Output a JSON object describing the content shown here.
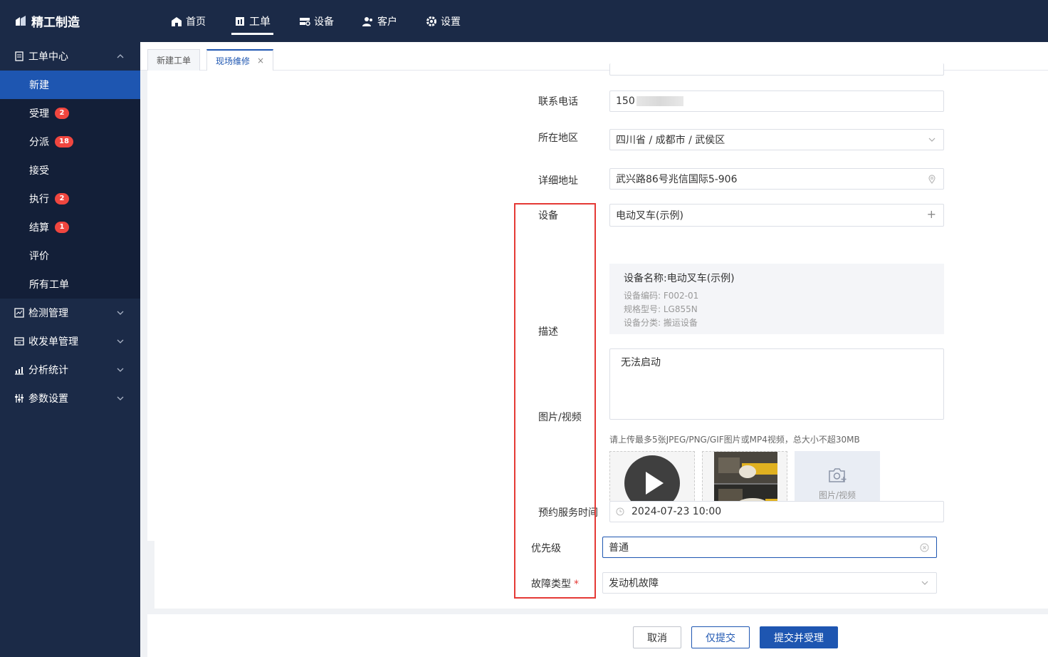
{
  "app": {
    "title": "精工制造"
  },
  "topnav": {
    "items": [
      {
        "label": "首页",
        "icon": "home-icon"
      },
      {
        "label": "工单",
        "icon": "workorder-icon",
        "active": true
      },
      {
        "label": "设备",
        "icon": "device-icon"
      },
      {
        "label": "客户",
        "icon": "customer-icon"
      },
      {
        "label": "设置",
        "icon": "gear-icon"
      }
    ]
  },
  "sidebar": {
    "group_workorder": "工单中心",
    "items": [
      {
        "label": "新建",
        "active": true
      },
      {
        "label": "受理",
        "badge": "2"
      },
      {
        "label": "分派",
        "badge": "18"
      },
      {
        "label": "接受"
      },
      {
        "label": "执行",
        "badge": "2"
      },
      {
        "label": "结算",
        "badge": "1"
      },
      {
        "label": "评价"
      },
      {
        "label": "所有工单"
      }
    ],
    "groups": [
      {
        "label": "检测管理",
        "icon": "inspection-icon"
      },
      {
        "label": "收发单管理",
        "icon": "shipping-icon"
      },
      {
        "label": "分析统计",
        "icon": "analytics-icon"
      },
      {
        "label": "参数设置",
        "icon": "params-icon"
      }
    ]
  },
  "tabs": [
    {
      "label": "新建工单"
    },
    {
      "label": "现场维修",
      "active": true,
      "close": "×"
    }
  ],
  "form": {
    "phone_label": "联系电话",
    "phone_value": "150",
    "region_label": "所在地区",
    "region_value": "四川省 / 成都市 / 武侯区",
    "address_label": "详细地址",
    "address_value": "武兴路86号兆信国际5-906",
    "device_label": "设备",
    "device_value": "电动叉车(示例)",
    "device_add": "+",
    "device_card": {
      "name": "设备名称:电动叉车(示例)",
      "code": "设备编码: F002-01",
      "model": "规格型号: LG855N",
      "category": "设备分类: 搬运设备"
    },
    "desc_label": "描述",
    "desc_value": "无法启动",
    "media_label": "图片/视频",
    "media_hint": "请上传最多5张JPEG/PNG/GIF图片或MP4视频，总大小不超30MB",
    "upload_label": "图片/视频",
    "appt_label": "预约服务时间",
    "appt_value": "2024-07-23 10:00",
    "priority_label": "优先级",
    "priority_value": "普通",
    "fault_label": "故障类型",
    "fault_required": "*",
    "fault_value": "发动机故障"
  },
  "footer": {
    "cancel": "取消",
    "submit_only": "仅提交",
    "submit_accept": "提交并受理"
  },
  "colors": {
    "nav_bg": "#1b2a47",
    "accent": "#1e56b1",
    "badge": "#f0463f",
    "highlight_box": "#e53935"
  }
}
